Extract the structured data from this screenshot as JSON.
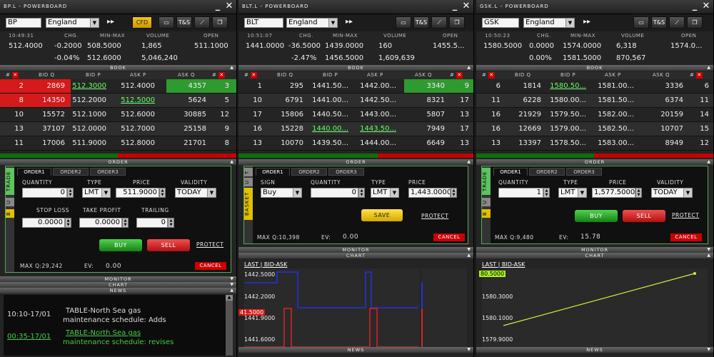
{
  "panels": [
    {
      "title": "BP.L - POWERBOARD",
      "symbol": "BP",
      "market": "England",
      "buttons": [
        "CFD",
        "T&S"
      ],
      "quote_hdr": [
        "10:49:31",
        "CHG.",
        "MIN-MAX",
        "VOLUME",
        "OPEN"
      ],
      "quote1": [
        "512.4000",
        "-0.2000",
        "508.5000",
        "1,865",
        "511.1000"
      ],
      "quote2": [
        "-0.04%",
        "512.6000",
        "5,046,240"
      ],
      "book_label": "BOOK",
      "book_hdr": [
        "#",
        "BID Q",
        "BID P",
        "ASK P",
        "ASK Q",
        "#"
      ],
      "rows": [
        [
          "2",
          "2869",
          "512.3000",
          "512.4000",
          "4357",
          "3"
        ],
        [
          "8",
          "14350",
          "512.2000",
          "512.5000",
          "5624",
          "5"
        ],
        [
          "10",
          "15572",
          "512.1000",
          "512.6000",
          "30885",
          "12"
        ],
        [
          "13",
          "37107",
          "512.0000",
          "512.7000",
          "25158",
          "9"
        ],
        [
          "11",
          "17006",
          "511.9000",
          "512.8000",
          "21701",
          "8"
        ]
      ],
      "order_label": "ORDER",
      "tabs": [
        "ORDER1",
        "ORDER2",
        "ORDER3"
      ],
      "side": "TRADE",
      "f_quantity": "QUANTITY",
      "v_quantity": "0",
      "f_type": "TYPE",
      "v_type": "LMT",
      "f_price": "PRICE",
      "v_price": "511.9000",
      "f_validity": "VALIDITY",
      "v_validity": "TODAY",
      "f_stop": "STOP LOSS",
      "v_stop": "0.0000",
      "f_take": "TAKE PROFIT",
      "v_take": "0.0000",
      "f_trail": "TRAILING",
      "v_trail": "0",
      "buy": "BUY",
      "sell": "SELL",
      "protect": "PROTECT",
      "max": "MAX Q:29,242",
      "ev": "EV:",
      "ev_v": "0.00",
      "cancel": "CANCEL",
      "monitor": "MONITOR",
      "chart": "CHART",
      "news_label": "NEWS",
      "news": [
        {
          "time": "10:10-17/01",
          "text1": "TABLE-North Sea gas",
          "text2": "maintenance schedule: Adds"
        },
        {
          "time": "00:35-17/01",
          "text1": "TABLE-North Sea gas",
          "text2": "maintenance schedule: revises"
        }
      ]
    },
    {
      "title": "BLT.L - POWERBOARD",
      "symbol": "BLT",
      "market": "England",
      "buttons": [
        "T&S"
      ],
      "quote_hdr": [
        "10:51:07",
        "CHG.",
        "MIN-MAX",
        "VOLUME",
        "OPEN"
      ],
      "quote1": [
        "1441.0000",
        "-36.5000",
        "1439.0000",
        "160",
        "1455.5..."
      ],
      "quote2": [
        "-2.47%",
        "1456.5000",
        "1,609,639"
      ],
      "book_label": "BOOK",
      "book_hdr": [
        "#",
        "BID Q",
        "BID P",
        "ASK P",
        "ASK Q",
        "#"
      ],
      "rows": [
        [
          "1",
          "295",
          "1441.50...",
          "1442.00...",
          "3340",
          "9"
        ],
        [
          "10",
          "6791",
          "1441.00...",
          "1442.50...",
          "8321",
          "17"
        ],
        [
          "17",
          "15806",
          "1440.50...",
          "1443.00...",
          "5807",
          "13"
        ],
        [
          "16",
          "15228",
          "1440.00...",
          "1443.50...",
          "7949",
          "17"
        ],
        [
          "13",
          "10070",
          "1439.50...",
          "1444.00...",
          "6649",
          "13"
        ]
      ],
      "order_label": "ORDER",
      "tabs": [
        "ORDER1",
        "ORDER2",
        "ORDER3"
      ],
      "side": "BASKET",
      "f_sign": "SIGN",
      "v_sign": "Buy",
      "f_quantity": "QUANTITY",
      "v_quantity": "0",
      "f_type": "TYPE",
      "v_type": "LMT",
      "f_price": "PRICE",
      "v_price": "1,443.0000",
      "save": "SAVE",
      "protect": "PROTECT",
      "max": "MAX Q:10,398",
      "ev": "EV:",
      "ev_v": "0.00",
      "cancel": "CANCEL",
      "monitor": "MONITOR",
      "chart": "CHART",
      "chart_tab": "LAST | BID-ASK",
      "ticks": [
        "1442.5000",
        "1442.2000",
        "1441.9000",
        "1441.6000"
      ],
      "flag": "41.5000",
      "news_label": "NEWS"
    },
    {
      "title": "GSK.L - POWERBOARD",
      "symbol": "GSK",
      "market": "England",
      "buttons": [
        "T&S"
      ],
      "quote_hdr": [
        "10:50:23",
        "CHG.",
        "MIN-MAX",
        "VOLUME",
        "OPEN"
      ],
      "quote1": [
        "1580.5000",
        "0.0000",
        "1574.0000",
        "6,318",
        "1574.0..."
      ],
      "quote2": [
        "0.00%",
        "1581.5000",
        "870,567"
      ],
      "book_label": "BOOK",
      "book_hdr": [
        "#",
        "BID Q",
        "BID P",
        "ASK P",
        "ASK Q",
        "#"
      ],
      "rows": [
        [
          "6",
          "1814",
          "1580.50...",
          "1581.00...",
          "3336",
          "6"
        ],
        [
          "11",
          "6228",
          "1580.00...",
          "1581.50...",
          "6374",
          "11"
        ],
        [
          "16",
          "21929",
          "1579.50...",
          "1582.00...",
          "20159",
          "14"
        ],
        [
          "16",
          "12669",
          "1579.00...",
          "1582.50...",
          "10707",
          "15"
        ],
        [
          "13",
          "13397",
          "1578.50...",
          "1583.00...",
          "8949",
          "12"
        ]
      ],
      "order_label": "ORDER",
      "tabs": [
        "ORDER1",
        "ORDER2",
        "ORDER3"
      ],
      "side": "TRADE",
      "f_quantity": "QUANTITY",
      "v_quantity": "1",
      "f_type": "TYPE",
      "v_type": "LMT",
      "f_price": "PRICE",
      "v_price": "1,577.5000",
      "f_validity": "VALIDITY",
      "v_validity": "TODAY",
      "buy": "BUY",
      "sell": "SELL",
      "protect": "PROTECT",
      "max": "MAX Q:9,480",
      "ev": "EV:",
      "ev_v": "15.78",
      "cancel": "CANCEL",
      "monitor": "MONITOR",
      "chart": "CHART",
      "chart_tab": "LAST | BID-ASK",
      "ticks": [
        "1580.3000",
        "1580.1000",
        "1579.9000"
      ],
      "flag": "80.5000",
      "news_label": "NEWS"
    }
  ],
  "colors": {
    "bid_highlight": "#d41a1a",
    "ask_highlight": "#2f9a2f",
    "cfd": "#f5c518"
  }
}
